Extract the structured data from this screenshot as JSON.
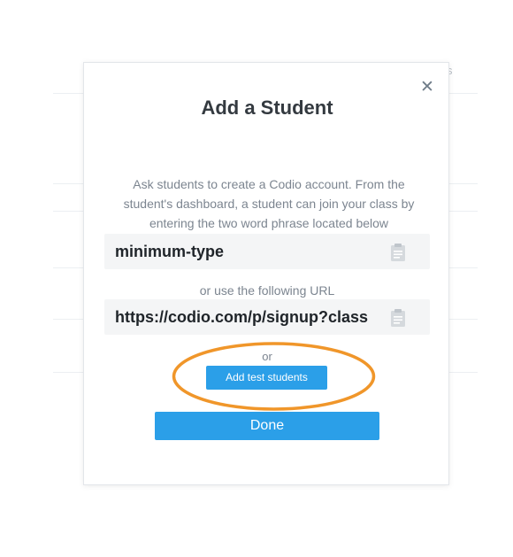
{
  "background": {
    "fragment_text": "s"
  },
  "modal": {
    "title": "Add a Student",
    "instructions": "Ask students to create a Codio account. From the student's dashboard, a student can join your class by entering the two word phrase located below",
    "phrase_value": "minimum-type",
    "url_label": "or use the following URL",
    "url_value": "https://codio.com/p/signup?class",
    "or_label": "or",
    "add_test_students_label": "Add test students",
    "done_label": "Done"
  },
  "icons": {
    "close": "close-icon",
    "clipboard": "clipboard-icon"
  },
  "colors": {
    "primary_button": "#2b9fe8",
    "highlight": "#f0962a",
    "title_text": "#343a40",
    "muted_text": "#7c8590"
  }
}
